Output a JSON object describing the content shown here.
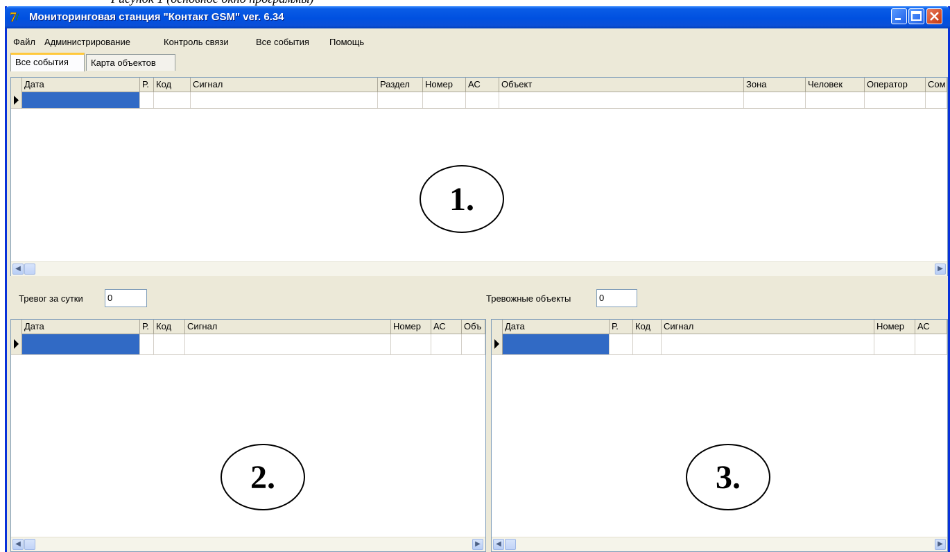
{
  "window": {
    "title": "Мониторинговая станция \"Контакт GSM\" ver. 6.34",
    "icon": "app-logo-icon"
  },
  "top_caption": "Рисунок 1 (основное окно программы)",
  "menu": [
    "Файл",
    "Администрирование",
    "Контроль связи",
    "Все события",
    "Помощь"
  ],
  "tabs": [
    "Все события",
    "Карта объектов"
  ],
  "grid1": {
    "columns": [
      "Дата",
      "Р.",
      "Код",
      "Сигнал",
      "Раздел",
      "Номер",
      "АС",
      "Объект",
      "Зона",
      "Человек",
      "Оператор",
      "Сом"
    ],
    "marker": "1."
  },
  "alarms_today": {
    "label": "Тревог за сутки",
    "value": "0"
  },
  "alarm_objects": {
    "label": "Тревожные объекты",
    "value": "0"
  },
  "grid2": {
    "columns": [
      "Дата",
      "Р.",
      "Код",
      "Сигнал",
      "Номер",
      "АС",
      "Объ"
    ],
    "marker": "2."
  },
  "grid3": {
    "columns": [
      "Дата",
      "Р.",
      "Код",
      "Сигнал",
      "Номер",
      "АС"
    ],
    "marker": "3."
  },
  "colors": {
    "titlebar": "#0050e0",
    "selection": "#316ac5",
    "face": "#ece9d8"
  }
}
